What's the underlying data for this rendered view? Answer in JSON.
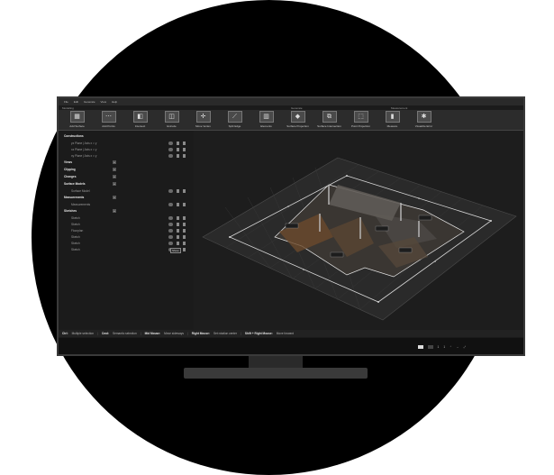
{
  "menu": [
    "File",
    "Edit",
    "Generate",
    "View",
    "Help"
  ],
  "sections": {
    "modeling": "Modelling",
    "generate": "Generate",
    "measurement": "Measurement"
  },
  "tools": [
    {
      "label": "Add Surface",
      "icon": "add-surface-icon",
      "glyph": "▦"
    },
    {
      "label": "Add Points",
      "icon": "add-points-icon",
      "glyph": "⋯"
    },
    {
      "label": "Intersect",
      "icon": "intersect-icon",
      "glyph": "◧"
    },
    {
      "label": "Extrude",
      "icon": "extrude-icon",
      "glyph": "◫"
    },
    {
      "label": "Move Vertex",
      "icon": "move-vertex-icon",
      "glyph": "✛"
    },
    {
      "label": "Split Edge",
      "icon": "split-edge-icon",
      "glyph": "⟋"
    },
    {
      "label": "Elements",
      "icon": "elements-icon",
      "glyph": "▥"
    },
    {
      "label": "Surface Projection",
      "icon": "surface-projection-icon",
      "glyph": "◆"
    },
    {
      "label": "Surface Intersection",
      "icon": "surface-intersection-icon",
      "glyph": "⧉"
    },
    {
      "label": "Point Projection",
      "icon": "point-projection-icon",
      "glyph": "⬚"
    },
    {
      "label": "Measure",
      "icon": "measure-icon",
      "glyph": "▮"
    },
    {
      "label": "Visualize Error",
      "icon": "visualize-error-icon",
      "glyph": "✱"
    }
  ],
  "tree": [
    {
      "label": "Constructions",
      "type": "head"
    },
    {
      "label": "yz Plane | Axis x = y",
      "type": "sub"
    },
    {
      "label": "xz Plane | Axis x = y",
      "type": "sub"
    },
    {
      "label": "xy Plane | Axis x = y",
      "type": "sub"
    },
    {
      "label": "Views",
      "type": "head"
    },
    {
      "label": "Clipping",
      "type": "head"
    },
    {
      "label": "Changes",
      "type": "head"
    },
    {
      "label": "Surface Models",
      "type": "head"
    },
    {
      "label": "Surface Model",
      "type": "sub"
    },
    {
      "label": "Measurements",
      "type": "head"
    },
    {
      "label": "Measurements",
      "type": "sub"
    },
    {
      "label": "Sketches",
      "type": "head"
    },
    {
      "label": "Sketch",
      "type": "sub"
    },
    {
      "label": "Sketch",
      "type": "sub"
    },
    {
      "label": "Floorplan",
      "type": "sub"
    },
    {
      "label": "Sketch",
      "type": "sub"
    },
    {
      "label": "Sketch",
      "type": "sub"
    },
    {
      "label": "Sketch",
      "type": "sub"
    }
  ],
  "tooltip": "Show",
  "status": [
    {
      "key": "Ctrl:",
      "value": "Multiple selection"
    },
    {
      "key": "Cmd:",
      "value": "Semantic selection"
    },
    {
      "key": "Mid Mouse:",
      "value": "Move sideways"
    },
    {
      "key": "Right Mouse:",
      "value": "Set rotation center"
    },
    {
      "key": "Shift + Right Mouse:",
      "value": "Move forward"
    }
  ],
  "pager": {
    "current": "1",
    "total": "1"
  }
}
